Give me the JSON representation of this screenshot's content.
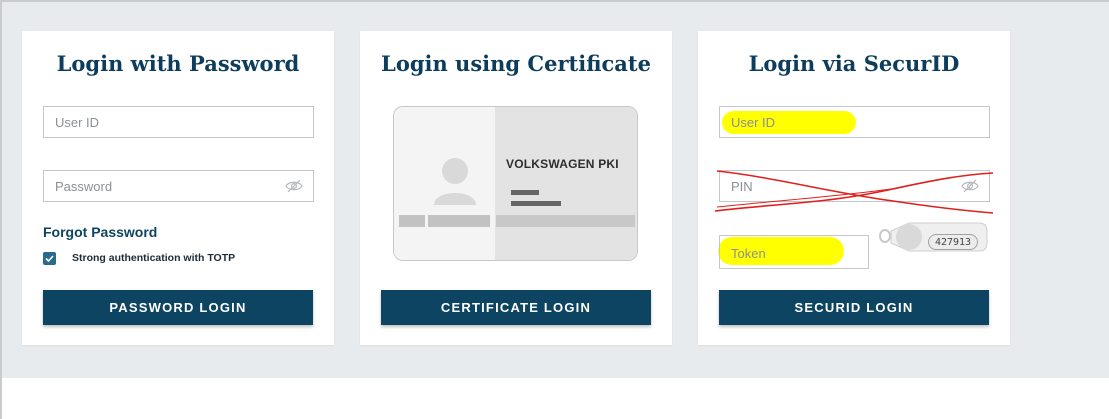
{
  "cards": {
    "password": {
      "title": "Login with Password",
      "user_id_placeholder": "User ID",
      "password_placeholder": "Password",
      "forgot_link": "Forgot Password",
      "totp_label": "Strong authentication with TOTP",
      "totp_checked": true,
      "button": "PASSWORD LOGIN"
    },
    "certificate": {
      "title": "Login using Certificate",
      "card_brand": "VOLKSWAGEN PKI",
      "button": "CERTIFICATE LOGIN"
    },
    "securid": {
      "title": "Login via SecurID",
      "user_id_placeholder": "User ID",
      "pin_placeholder": "PIN",
      "token_placeholder": "Token",
      "token_display": "427913",
      "button": "SECURID LOGIN"
    }
  },
  "colors": {
    "brand": "#0d3c5c",
    "button": "#0d4461",
    "background": "#e8ebee",
    "highlight": "#ffff00",
    "scribble": "#e0201c"
  }
}
